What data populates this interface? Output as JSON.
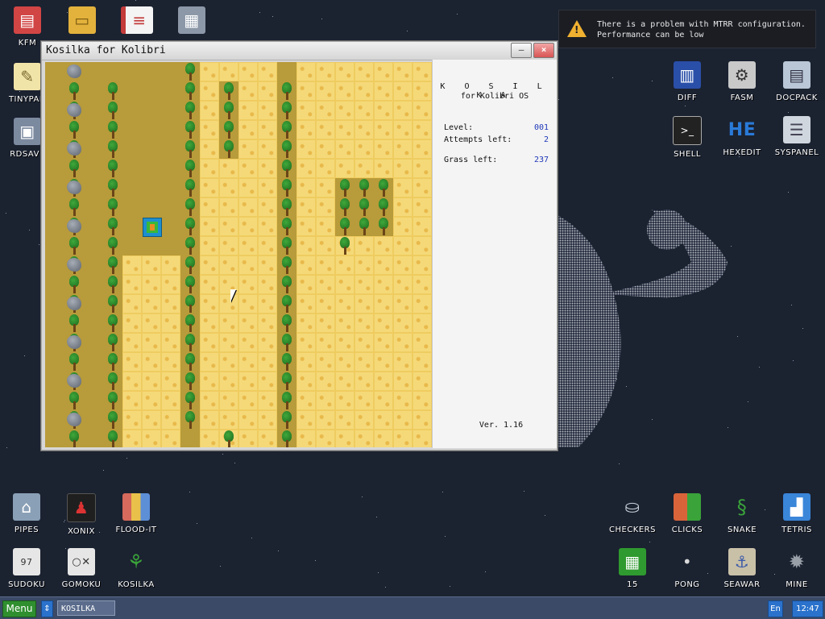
{
  "desktop": {
    "left_icons": [
      {
        "label": "KFM",
        "icon": "floppy-disk-icon",
        "color": "#d24545"
      },
      {
        "label": "",
        "icon": "folder-icon",
        "color": "#e3b23c"
      },
      {
        "label": "",
        "icon": "book-icon",
        "color": "#c33b3b"
      },
      {
        "label": "",
        "icon": "calculator-icon",
        "color": "#8c98a8"
      },
      {
        "label": "TINYPAD",
        "icon": "notepad-icon",
        "color": "#e8d48a"
      },
      {
        "label": "RDSAVE",
        "icon": "save-icon",
        "color": "#7c8aa0"
      }
    ],
    "right_icons": [
      {
        "label": "DIFF",
        "icon": "diff-icon",
        "color": "#2a4fa8"
      },
      {
        "label": "FASM",
        "icon": "fasm-icon",
        "color": "#c9c9c9"
      },
      {
        "label": "DOCPACK",
        "icon": "docpack-icon",
        "color": "#b9c7d6"
      },
      {
        "label": "SHELL",
        "icon": "terminal-icon",
        "color": "#222222"
      },
      {
        "label": "HEXEDIT",
        "icon": "hexedit-icon",
        "color": "#2a7ad8"
      },
      {
        "label": "SYSPANEL",
        "icon": "syspanel-icon",
        "color": "#d0d6de"
      }
    ],
    "bottom_left_icons": [
      {
        "label": "PIPES",
        "icon": "pipes-icon",
        "color": "#8aa0b6"
      },
      {
        "label": "XONIX",
        "icon": "xonix-icon",
        "color": "#1f1f1f"
      },
      {
        "label": "FLOOD-IT",
        "icon": "flood-it-icon",
        "color": "#d66a5c"
      },
      {
        "label": "SUDOKU",
        "icon": "sudoku-icon",
        "color": "#e6e6e6"
      },
      {
        "label": "GOMOKU",
        "icon": "gomoku-icon",
        "color": "#e6e6e6"
      },
      {
        "label": "KOSILKA",
        "icon": "lawn-mower-icon",
        "color": "#3aa33a"
      }
    ],
    "bottom_right_icons": [
      {
        "label": "CHECKERS",
        "icon": "checkers-icon",
        "color": "#c8d0da"
      },
      {
        "label": "CLICKS",
        "icon": "clicks-icon",
        "color": "#d9643a"
      },
      {
        "label": "SNAKE",
        "icon": "snake-icon",
        "color": "#3aa33a"
      },
      {
        "label": "TETRIS",
        "icon": "tetris-icon",
        "color": "#3a86d9"
      },
      {
        "label": "15",
        "icon": "fifteen-icon",
        "color": "#2f9a2f"
      },
      {
        "label": "PONG",
        "icon": "pong-icon",
        "color": "#d9d9d9"
      },
      {
        "label": "SEAWAR",
        "icon": "seawar-icon",
        "color": "#c9c0a8"
      },
      {
        "label": "MINE",
        "icon": "mine-icon",
        "color": "#9aa0a8"
      }
    ]
  },
  "notification": {
    "line1": "There is a problem with MTRR configuration.",
    "line2": "Performance can be low"
  },
  "window": {
    "title": "Kosilka for Kolibri",
    "minimize_label": "—",
    "close_label": "×"
  },
  "panel": {
    "title": "K O S I L K A",
    "subtitle": "for Kolibri OS",
    "level_label": "Level:",
    "level_value": "001",
    "attempts_label": "Attempts left:",
    "attempts_value": "2",
    "grass_label": "Grass left:",
    "grass_value": "237",
    "version": "Ver. 1.16"
  },
  "taskbar": {
    "menu_label": "Menu",
    "task_label": "KOSILKA",
    "lang": "En",
    "clock": "12:47"
  }
}
